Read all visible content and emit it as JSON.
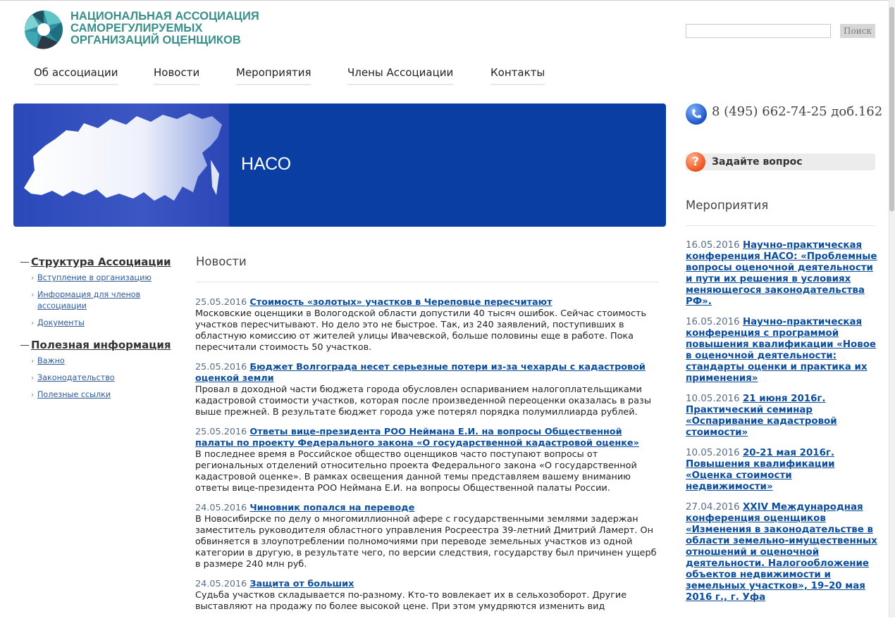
{
  "header": {
    "logo_lines": [
      "НАЦИОНАЛЬНАЯ АССОЦИАЦИЯ",
      "САМОРЕГУЛИРУЕМЫХ",
      "ОРГАНИЗАЦИЙ ОЦЕНЩИКОВ"
    ],
    "search_placeholder": "",
    "search_button": "Поиск"
  },
  "nav": [
    "Об ассоциации",
    "Новости",
    "Мероприятия",
    "Члены Ассоциации",
    "Контакты"
  ],
  "banner": {
    "title": "НАСО"
  },
  "contact": {
    "phone": "8 (495) 662-74-25 доб.162",
    "ask": "Задайте вопрос"
  },
  "sidebar": {
    "groups": [
      {
        "title": "Структура Ассоциации",
        "items": [
          "Вступление в организацию",
          "Информация для членов ассоциации",
          "Документы"
        ]
      },
      {
        "title": "Полезная информация",
        "items": [
          "Важно",
          "Законодательство",
          "Полезные ссылки"
        ]
      }
    ]
  },
  "main": {
    "heading": "Новости",
    "news": [
      {
        "date": "25.05.2016",
        "title": "Стоимость «золотых» участков в Череповце пересчитают",
        "text": "Московские оценщики в Вологодской области допустили 40 тысяч ошибок. Сейчас стоимость участков пересчитывают. Но дело это не быстрое. Так, из 240 заявлений, поступивших в областную комиссию от жителей улицы Ивачевской, больше половины еще в работе. Пока пересчитали стоимость 50 участков."
      },
      {
        "date": "25.05.2016",
        "title": "Бюджет Волгограда несет серьезные потери из-за чехарды с кадастровой оценкой земли",
        "text": "Провал в доходной части бюджета города обусловлен оспариванием налогоплательщиками кадастровой стоимости участков, которая после произведенной переоценки оказалась в разы выше прежней. В результате  бюджет города уже потерял порядка полумиллиарда рублей."
      },
      {
        "date": "25.05.2016",
        "title": "Ответы вице-президента РОО Неймана Е.И. на вопросы Общественной палаты по проекту Федерального закона «О государственной кадастровой оценке»",
        "text": "В последнее время в Российское общество оценщиков часто поступают вопросы от региональных отделений относительно проекта Федерального закона «О государственной кадастровой оценке». В рамках освещения данной темы представляем вашему вниманию ответы вице-президента РОО Неймана Е.И. на вопросы Общественной палаты России."
      },
      {
        "date": "24.05.2016",
        "title": "Чиновник попался на переводе",
        "text": "В Новосибирске по делу о многомиллионной афере с государственными землями задержан заместитель руководителя областного управления Росреестра 39-летний Дмитрий Ламерт. Он обвиняется в злоупотреблении полномочиями при переводе земельных участков из одной категории в другую, в результате чего, по версии следствия, государству был причинен ущерб в размере 240 млн руб."
      },
      {
        "date": "24.05.2016",
        "title": "Защита от больших",
        "text": "Судьба участков складывается по-разному. Кто-то вовлекает их в сельхозоборот. Другие выставляют на продажу по более высокой цене. При этом умудряются изменить вид"
      }
    ]
  },
  "right": {
    "heading": "Мероприятия",
    "events": [
      {
        "date": "16.05.2016",
        "title": "Научно-практическая конференция НАСО: «Проблемные вопросы оценочной деятельности и пути их решения в условиях меняющегося законодательства РФ»."
      },
      {
        "date": "16.05.2016",
        "title": "Научно-практическая конференция с программой повышения квалификации «Новое в оценочной деятельности: стандарты оценки и практика их применения»"
      },
      {
        "date": "10.05.2016",
        "title": "21 июня 2016г. Практический семинар «Оспаривание кадастровой стоимости»"
      },
      {
        "date": "10.05.2016",
        "title": "20-21 мая 2016г. Повышения квалификации «Оценка стоимости недвижимости»"
      },
      {
        "date": "27.04.2016",
        "title": "XXIV Международная конференция оценщиков «Изменения в законодательстве в области земельно-имущественных отношений и оценочной деятельности. Налогообложение объектов недвижимости и земельных участков», 19–20 мая 2016 г., г. Уфа"
      }
    ]
  },
  "colors": {
    "brand_teal": "#3a8f8a",
    "banner_blue": "#0b3ea3",
    "link_blue": "#0a4d9c"
  }
}
